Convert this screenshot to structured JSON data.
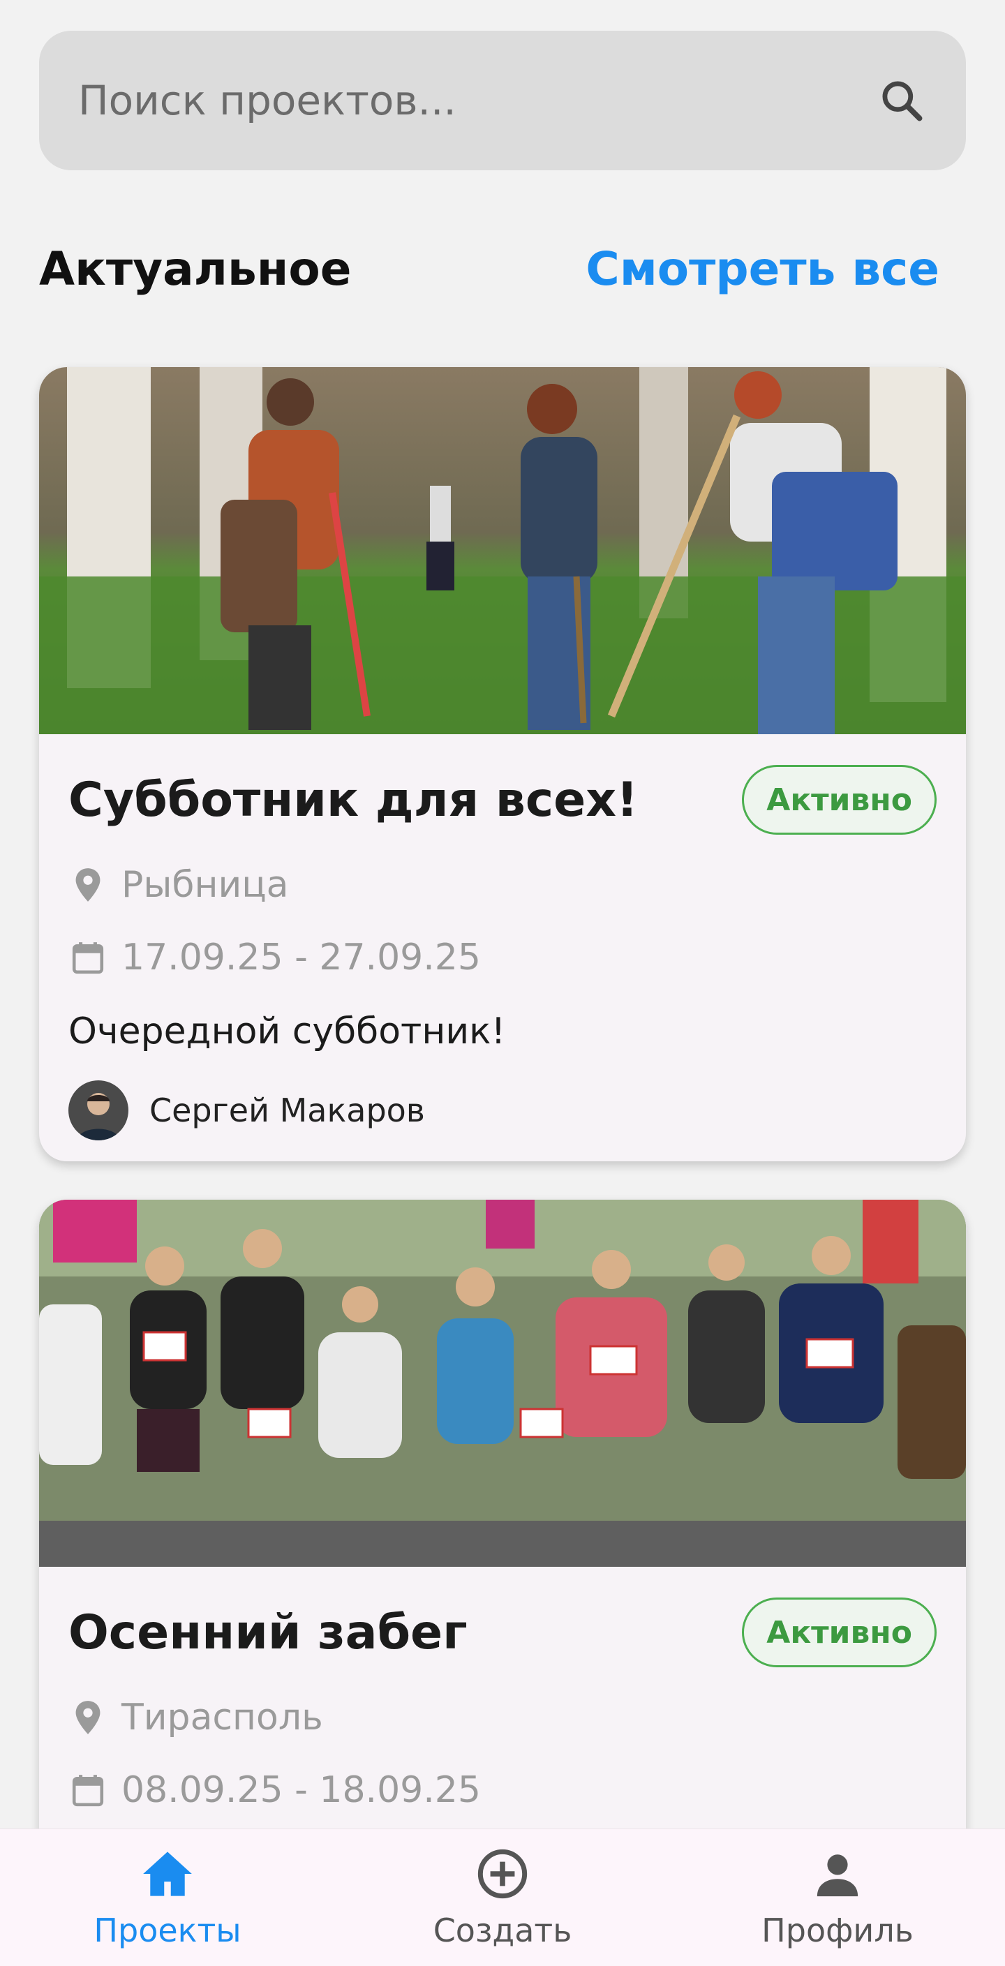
{
  "search": {
    "placeholder": "Поиск проектов..."
  },
  "section": {
    "title": "Актуальное",
    "see_all": "Смотреть все"
  },
  "projects": [
    {
      "title": "Субботник для всех!",
      "status": "Активно",
      "location": "Рыбница",
      "dates": "17.09.25 - 27.09.25",
      "description": "Очередной субботник!",
      "author": "Сергей Макаров"
    },
    {
      "title": "Осенний забег",
      "status": "Активно",
      "location": "Тирасполь",
      "dates": "08.09.25 - 18.09.25"
    }
  ],
  "nav": [
    {
      "label": "Проекты",
      "icon": "home-icon",
      "active": true
    },
    {
      "label": "Создать",
      "icon": "add-circle-icon",
      "active": false
    },
    {
      "label": "Профиль",
      "icon": "person-icon",
      "active": false
    }
  ],
  "colors": {
    "accent": "#1a8cf0",
    "status": "#4caf50"
  }
}
